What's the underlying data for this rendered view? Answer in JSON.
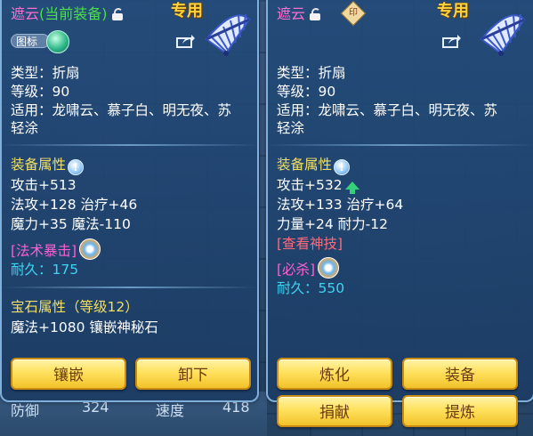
{
  "background": {
    "bottom_left_label": "防御",
    "bottom_left_value": "324",
    "bottom_mid_label": "速度",
    "bottom_mid_value": "418"
  },
  "left": {
    "name": "遮云",
    "current_tag": "(当前装备)",
    "special": "专用",
    "icon_label": "图标",
    "type_line": "类型：折扇",
    "level_line": "等级：90",
    "use_line1": "适用：龙啸云、慕子白、明无夜、苏",
    "use_line2": "轻涂",
    "attr_header": "装备属性",
    "stat1": "攻击+513",
    "stat2": "法攻+128  治疗+46",
    "stat3": "魔力+35  魔法-110",
    "skill": "[法术暴击]",
    "durability": "耐久：175",
    "gem_header": "宝石属性（等级12）",
    "gem_stat": "魔法+1080  镶嵌神秘石",
    "btn_inlay": "镶嵌",
    "btn_unequip": "卸下"
  },
  "right": {
    "name": "遮云",
    "seal_char": "印",
    "special": "专用",
    "type_line": "类型：折扇",
    "level_line": "等级：90",
    "use_line1": "适用：龙啸云、慕子白、明无夜、苏",
    "use_line2": "轻涂",
    "attr_header": "装备属性",
    "stat1": "攻击+532",
    "stat2": "法攻+133  治疗+64",
    "stat3": "力量+24  耐力-12",
    "view_skill": "[查看神技]",
    "skill": "[必杀]",
    "durability": "耐久：550",
    "btn_refine": "炼化",
    "btn_equip": "装备",
    "btn_donate": "捐献",
    "btn_extract": "提炼"
  },
  "colors": {
    "name": "#ff6fd0",
    "current": "#49e04a",
    "special": "#ffd23a",
    "header": "#f2df62",
    "durability": "#3fd3f2",
    "skill_pink": "#ff5fd2",
    "skill_red": "#ff6a7a",
    "button": "#ffe15e"
  }
}
